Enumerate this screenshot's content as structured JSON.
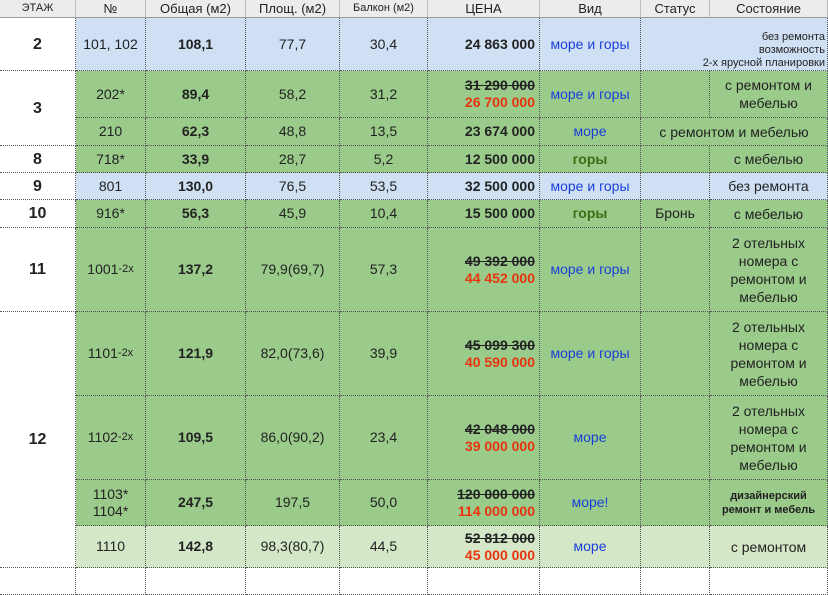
{
  "header": {
    "floor": "ЭТАЖ",
    "number": "№",
    "total": "Общая (м2)",
    "area": "Площ. (м2)",
    "balcony": "Балкон (м2)",
    "price": "ЦЕНА",
    "view": "Вид",
    "status": "Статус",
    "condition": "Состояние"
  },
  "floors": {
    "f2": "2",
    "f3": "3",
    "f8": "8",
    "f9": "9",
    "f10": "10",
    "f11": "11",
    "f12": "12"
  },
  "rows": [
    {
      "num": "101, 102",
      "total": "108,1",
      "area": "77,7",
      "balcony": "30,4",
      "price_old": "",
      "price": "24 863 000",
      "view": "море и горы",
      "status": "",
      "cond_lines": [
        "без ремонта",
        "возможность",
        "2-х ярусной планировки"
      ],
      "color": "#cfe0f5"
    },
    {
      "num": "202*",
      "total": "89,4",
      "area": "58,2",
      "balcony": "31,2",
      "price_old": "31 290 000",
      "price": "26 700 000",
      "view": "море и горы",
      "status": "",
      "cond": "с ремонтом и мебелью",
      "color": "#9bcb8a"
    },
    {
      "num": "210",
      "total": "62,3",
      "area": "48,8",
      "balcony": "13,5",
      "price_old": "",
      "price": "23 674 000",
      "view": "море",
      "status": "",
      "cond": "с ремонтом и мебелью",
      "color": "#9bcb8a"
    },
    {
      "num": "718*",
      "total": "33,9",
      "area": "28,7",
      "balcony": "5,2",
      "price_old": "",
      "price": "12 500 000",
      "view": "горы",
      "status": "",
      "cond": "с мебелью",
      "color": "#9bcb8a"
    },
    {
      "num": "801",
      "total": "130,0",
      "area": "76,5",
      "balcony": "53,5",
      "price_old": "",
      "price": "32 500 000",
      "view": "море и горы",
      "status": "",
      "cond": "без ремонта",
      "color": "#cfe0f5"
    },
    {
      "num": "916*",
      "total": "56,3",
      "area": "45,9",
      "balcony": "10,4",
      "price_old": "",
      "price": "15 500 000",
      "view": "горы",
      "status": "Бронь",
      "cond": "с мебелью",
      "color": "#9bcb8a"
    },
    {
      "num": "1001",
      "num_sub": "-2x",
      "total": "137,2",
      "area": "79,9(69,7)",
      "balcony": "57,3",
      "price_old": "49 392 000",
      "price": "44 452 000",
      "view": "море и горы",
      "status": "",
      "cond": "2 отельных номера с ремонтом и мебелью",
      "color": "#9bcb8a"
    },
    {
      "num": "1101",
      "num_sub": "-2x",
      "total": "121,9",
      "area": "82,0(73,6)",
      "balcony": "39,9",
      "price_old": "45 099 300",
      "price": "40 590 000",
      "view": "море и горы",
      "status": "",
      "cond": "2 отельных номера с ремонтом и мебелью",
      "color": "#9bcb8a"
    },
    {
      "num": "1102",
      "num_sub": "-2x",
      "total": "109,5",
      "area": "86,0(90,2)",
      "balcony": "23,4",
      "price_old": "42 048 000",
      "price": "39 000 000",
      "view": "море",
      "status": "",
      "cond": "2 отельных номера с ремонтом и мебелью",
      "color": "#9bcb8a"
    },
    {
      "num": "1103* 1104*",
      "total": "247,5",
      "area": "197,5",
      "balcony": "50,0",
      "price_old": "120 000 000",
      "price": "114 000 000",
      "view": "море!",
      "status": "",
      "cond": "дизайнерский ремонт и мебель",
      "color": "#9bcb8a"
    },
    {
      "num": "1110",
      "total": "142,8",
      "area": "98,3(80,7)",
      "balcony": "44,5",
      "price_old": "52 812 000",
      "price": "45 000 000",
      "view": "море",
      "status": "",
      "cond": "с ремонтом",
      "color": "#d4e8c8"
    }
  ]
}
